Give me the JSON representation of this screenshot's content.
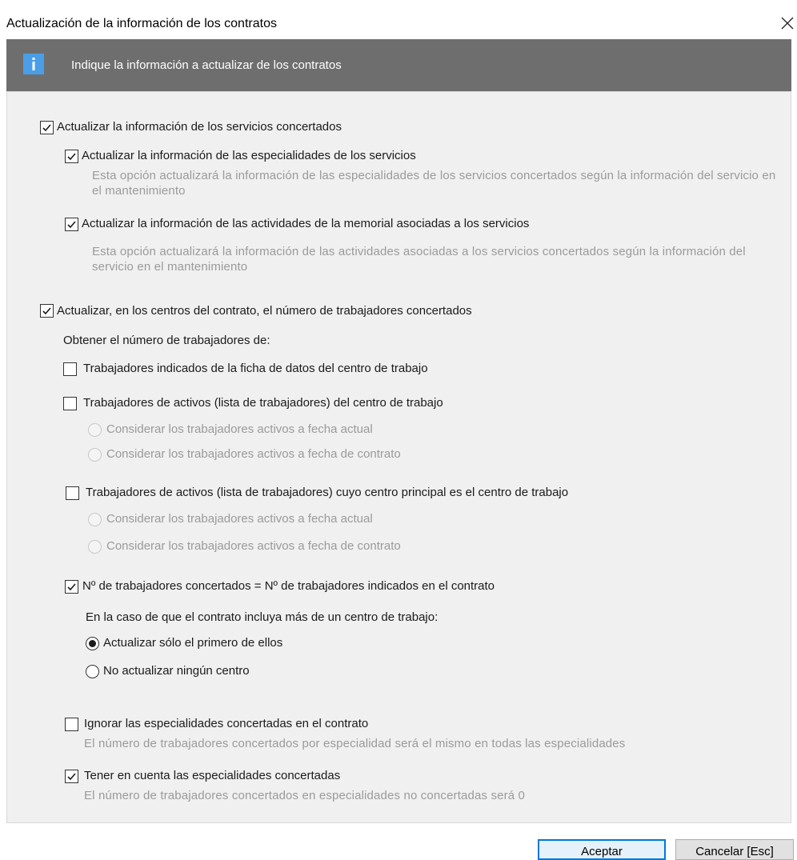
{
  "window": {
    "title": "Actualización de la información de los contratos"
  },
  "banner": {
    "text": "Indique la información a actualizar de los contratos",
    "icon": "info-icon",
    "icon_color": "#4a9ee8"
  },
  "services": {
    "label": "Actualizar la información de los servicios concertados",
    "checked": true,
    "specialties": {
      "label": "Actualizar la información de las especialidades de los servicios",
      "checked": true,
      "description": "Esta opción actualizará la información de las especialidades de los servicios concertados según la información del servicio en el mantenimiento"
    },
    "activities": {
      "label": "Actualizar la información de las actividades de la memorial asociadas a los servicios",
      "checked": true,
      "description": "Esta opción actualizará la información de las actividades asociadas a los servicios concertados según la información del servicio en el mantenimiento"
    }
  },
  "workers": {
    "label": "Actualizar, en los centros del contrato, el número de trabajadores concertados",
    "checked": true,
    "source_heading": "Obtener el número de trabajadores de:",
    "from_file": {
      "label": "Trabajadores indicados de la ficha de datos del centro de trabajo",
      "checked": false
    },
    "active_center": {
      "label": "Trabajadores de activos (lista de trabajadores) del centro de trabajo",
      "checked": false,
      "option_current": "Considerar los trabajadores activos a fecha actual",
      "option_contract": "Considerar los trabajadores activos a fecha de contrato"
    },
    "active_main": {
      "label": "Trabajadores de activos (lista de trabajadores) cuyo centro principal es el centro de trabajo",
      "checked": false,
      "option_current": "Considerar los trabajadores activos a fecha actual",
      "option_contract": "Considerar los trabajadores activos a fecha de contrato"
    },
    "contract_count": {
      "label": "Nº de trabajadores concertados = Nº de trabajadores indicados en el contrato",
      "checked": true,
      "case_heading": "En la caso de que el contrato incluya más de un centro de trabajo:",
      "option_first": "Actualizar sólo el primero de ellos",
      "option_first_selected": true,
      "option_none": "No actualizar ningún centro"
    },
    "ignore_specialties": {
      "label": "Ignorar las especialidades concertadas en el contrato",
      "checked": false,
      "description": "El número de trabajadores concertados por especialidad será el mismo en todas las especialidades"
    },
    "consider_specialties": {
      "label": "Tener en cuenta las especialidades concertadas",
      "checked": true,
      "description": "El número de trabajadores concertados en especialidades no concertadas será 0"
    }
  },
  "buttons": {
    "accept": "Aceptar",
    "cancel": "Cancelar [Esc]"
  }
}
